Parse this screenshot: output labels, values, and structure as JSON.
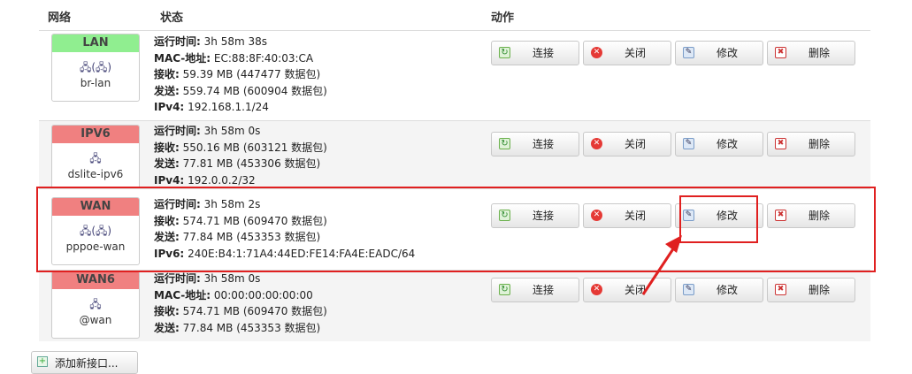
{
  "headers": {
    "network": "网络",
    "status": "状态",
    "actions": "动作"
  },
  "buttons": {
    "connect": "连接",
    "close": "关闭",
    "edit": "修改",
    "delete": "删除"
  },
  "add_interface": "添加新接口...",
  "rows": [
    {
      "name": "LAN",
      "state_color": "green",
      "icons": "🖧(🖧)",
      "device": "br-lan",
      "lines": [
        {
          "k": "运行时间:",
          "v": "3h 58m 38s"
        },
        {
          "k": "MAC-地址:",
          "v": "EC:88:8F:40:03:CA"
        },
        {
          "k": "接收:",
          "v": "59.39 MB (447477 数据包)"
        },
        {
          "k": "发送:",
          "v": "559.74 MB (600904 数据包)"
        },
        {
          "k": "IPv4:",
          "v": "192.168.1.1/24"
        }
      ]
    },
    {
      "name": "IPV6",
      "state_color": "red",
      "icons": "🖧",
      "device": "dslite-ipv6",
      "lines": [
        {
          "k": "运行时间:",
          "v": "3h 58m 0s"
        },
        {
          "k": "接收:",
          "v": "550.16 MB (603121 数据包)"
        },
        {
          "k": "发送:",
          "v": "77.81 MB (453306 数据包)"
        },
        {
          "k": "IPv4:",
          "v": "192.0.0.2/32"
        }
      ]
    },
    {
      "name": "WAN",
      "state_color": "red",
      "icons": "🖧(🖧)",
      "device": "pppoe-wan",
      "lines": [
        {
          "k": "运行时间:",
          "v": "3h 58m 2s"
        },
        {
          "k": "接收:",
          "v": "574.71 MB (609470 数据包)"
        },
        {
          "k": "发送:",
          "v": "77.84 MB (453353 数据包)"
        },
        {
          "k": "IPv6:",
          "v": "240E:B4:1:71A4:44ED:FE14:FA4E:EADC/64"
        }
      ]
    },
    {
      "name": "WAN6",
      "state_color": "red",
      "icons": "🖧",
      "device": "@wan",
      "lines": [
        {
          "k": "运行时间:",
          "v": "3h 58m 0s"
        },
        {
          "k": "MAC-地址:",
          "v": "00:00:00:00:00:00"
        },
        {
          "k": "接收:",
          "v": "574.71 MB (609470 数据包)"
        },
        {
          "k": "发送:",
          "v": "77.84 MB (453353 数据包)"
        }
      ]
    }
  ],
  "annotation_color": "#e02020"
}
